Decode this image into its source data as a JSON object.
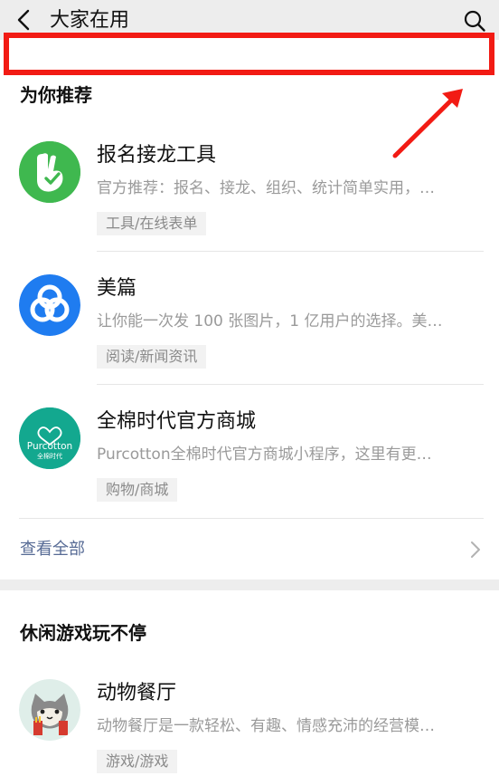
{
  "header": {
    "title": "大家在用"
  },
  "recommend": {
    "section_title": "为你推荐",
    "items": [
      {
        "name": "报名接龙工具",
        "desc": "官方推荐：报名、接龙、组织、统计简单实用，…",
        "tag": "工具/在线表单",
        "icon": "hand-check-icon"
      },
      {
        "name": "美篇",
        "desc": "让你能一次发 100 张图片，1 亿用户的选择。美…",
        "tag": "阅读/新闻资讯",
        "icon": "meipian-logo-icon"
      },
      {
        "name": "全棉时代官方商城",
        "desc": "Purcotton全棉时代官方商城小程序，这里有更…",
        "tag": "购物/商城",
        "icon": "purcotton-logo-icon",
        "logo_text": "Purcotton",
        "logo_subtext": "全棉时代"
      }
    ],
    "view_all": "查看全部"
  },
  "games": {
    "section_title": "休闲游戏玩不停",
    "items": [
      {
        "name": "动物餐厅",
        "desc": "动物餐厅是一款轻松、有趣、情感充沛的经营模…",
        "tag": "游戏/游戏",
        "icon": "cat-chef-icon"
      }
    ]
  },
  "colors": {
    "highlight": "#f21b14",
    "link": "#576b95",
    "green_logo": "#3fb84f",
    "blue_logo": "#1f7cf0",
    "teal_logo": "#13a88f"
  }
}
